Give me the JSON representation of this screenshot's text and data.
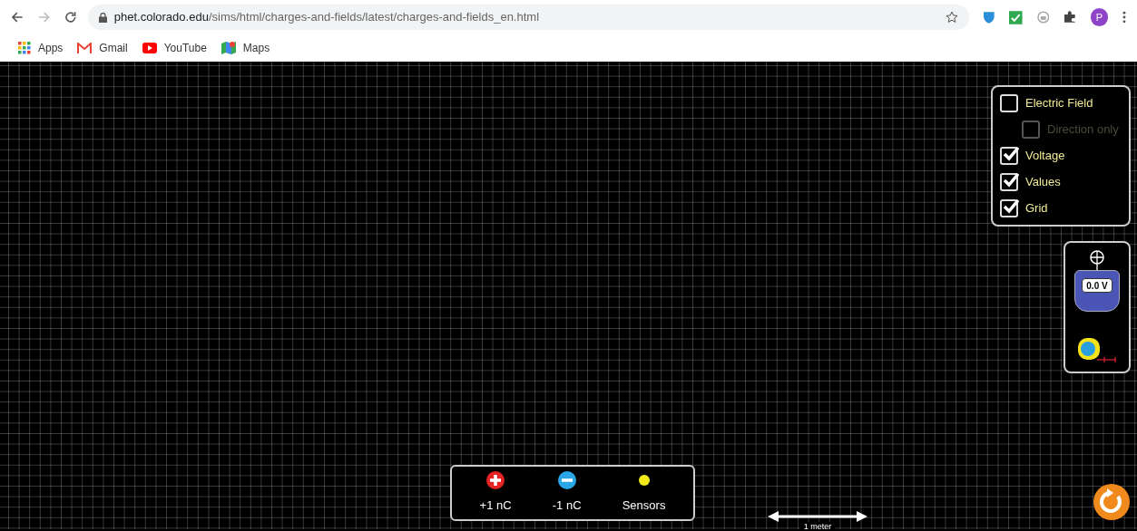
{
  "browser": {
    "url_host": "phet.colorado.edu",
    "url_path": "/sims/html/charges-and-fields/latest/charges-and-fields_en.html",
    "profile_initial": "P",
    "bookmarks": [
      {
        "kind": "apps",
        "label": "Apps"
      },
      {
        "kind": "gmail",
        "label": "Gmail"
      },
      {
        "kind": "youtube",
        "label": "YouTube"
      },
      {
        "kind": "maps",
        "label": "Maps"
      }
    ]
  },
  "controls": [
    {
      "label": "Electric Field",
      "checked": false,
      "disabled": false,
      "children": [
        {
          "label": "Direction only",
          "checked": false,
          "disabled": true
        }
      ]
    },
    {
      "label": "Voltage",
      "checked": true,
      "disabled": false
    },
    {
      "label": "Values",
      "checked": true,
      "disabled": false
    },
    {
      "label": "Grid",
      "checked": true,
      "disabled": false
    }
  ],
  "voltmeter": {
    "reading": "0.0 V"
  },
  "charges": [
    {
      "kind": "positive",
      "label": "+1 nC"
    },
    {
      "kind": "negative",
      "label": "-1 nC"
    },
    {
      "kind": "sensor",
      "label": "Sensors"
    }
  ],
  "scale": {
    "label": "1 meter"
  }
}
